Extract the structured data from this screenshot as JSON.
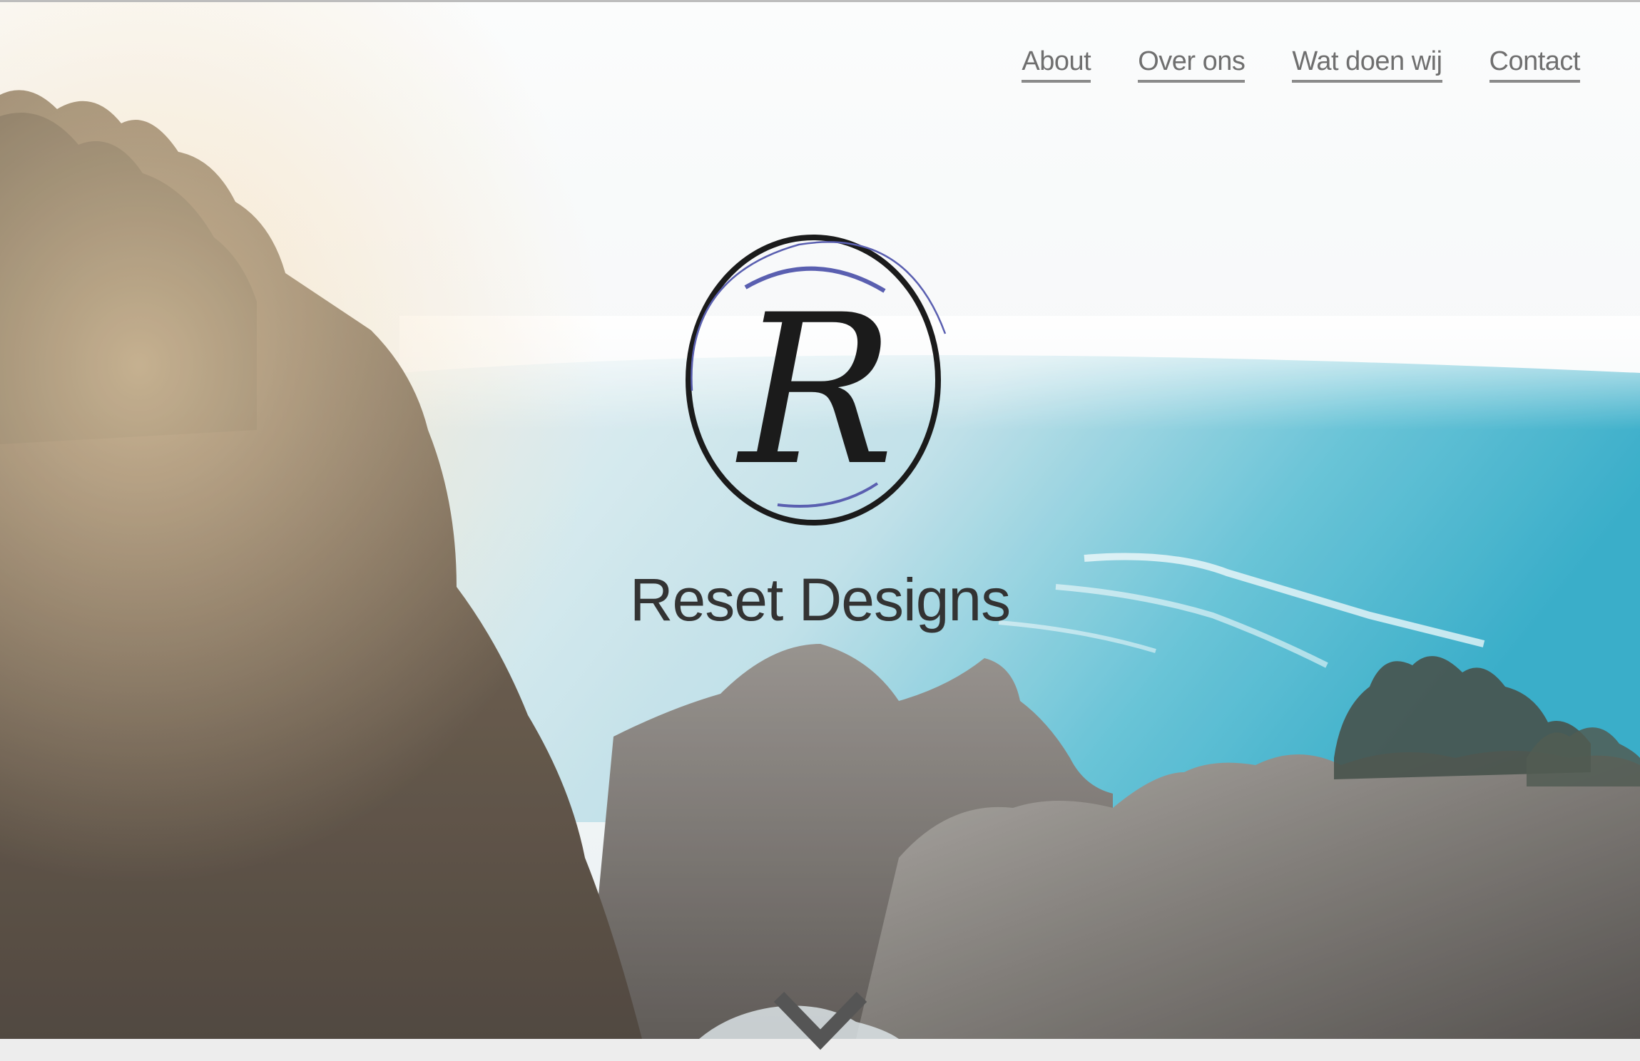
{
  "nav": {
    "items": [
      {
        "label": "About"
      },
      {
        "label": "Over ons"
      },
      {
        "label": "Wat doen wij"
      },
      {
        "label": "Contact"
      }
    ]
  },
  "hero": {
    "logo_letter": "R",
    "brand_name": "Reset Designs",
    "background": "coastal-cliffs-ocean-photo"
  },
  "icons": {
    "scroll": "chevron-down-icon"
  },
  "colors": {
    "nav_text": "#6f6f6f",
    "brand_text": "#333333",
    "logo_ring_dark": "#1b1b1b",
    "logo_ring_blue": "#5a5fb0",
    "ocean": "#2aa7c4",
    "chevron": "#555555"
  }
}
